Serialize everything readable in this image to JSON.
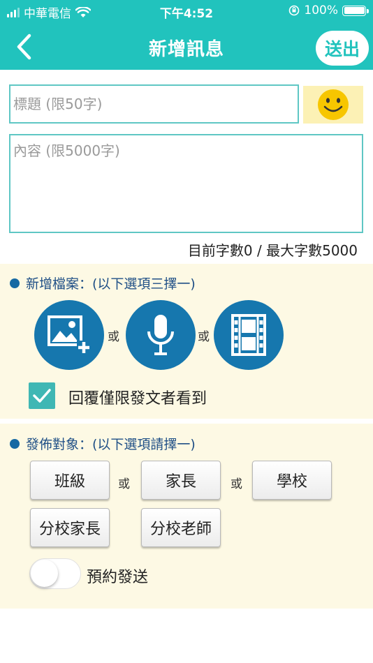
{
  "status_bar": {
    "carrier": "中華電信",
    "time": "下午4:52",
    "battery": "100%"
  },
  "nav": {
    "title": "新增訊息",
    "send_label": "送出"
  },
  "compose": {
    "title_placeholder": "標題 (限50字)",
    "title_value": "",
    "content_placeholder": "內容 (限5000字)",
    "content_value": "",
    "char_count_text": "目前字數0 / 最大字數5000"
  },
  "attachments": {
    "heading": "新增檔案：(以下選項三擇一)",
    "or_label_1": "或",
    "or_label_2": "或",
    "reply_restrict_label": "回覆僅限發文者看到",
    "reply_restrict_checked": true
  },
  "target": {
    "heading": "發佈對象：(以下選項請擇一)",
    "or_label_1": "或",
    "or_label_2": "或",
    "options": [
      "班級",
      "家長",
      "學校",
      "分校家長",
      "分校老師"
    ],
    "schedule_label": "預約發送",
    "schedule_enabled": false
  },
  "colors": {
    "header": "#21c3bd",
    "accent_blue": "#1677ae",
    "section_bg": "#fdf9e4",
    "emoji_bg": "#fcf1b5"
  },
  "icons": {
    "back": "chevron-left-icon",
    "emoji": "smiley-icon",
    "image": "add-image-icon",
    "audio": "microphone-icon",
    "video": "film-icon",
    "check": "checkmark-icon"
  }
}
